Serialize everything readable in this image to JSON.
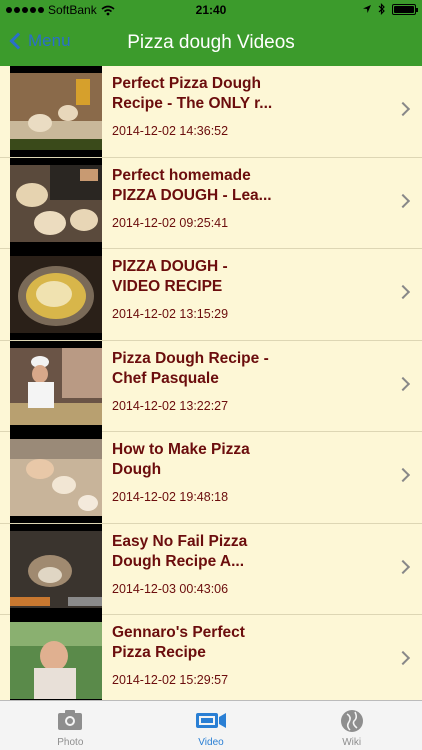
{
  "status_bar": {
    "carrier": "SoftBank",
    "time": "21:40"
  },
  "nav": {
    "back_label": "Menu",
    "title": "Pizza dough Videos"
  },
  "videos": [
    {
      "title": "Perfect Pizza Dough\nRecipe - The ONLY r...",
      "date": "2014-12-02 14:36:52"
    },
    {
      "title": "Perfect homemade\nPIZZA DOUGH - Lea...",
      "date": "2014-12-02 09:25:41"
    },
    {
      "title": "PIZZA DOUGH -\nVIDEO RECIPE",
      "date": "2014-12-02 13:15:29"
    },
    {
      "title": "Pizza Dough Recipe -\nChef Pasquale",
      "date": "2014-12-02 13:22:27"
    },
    {
      "title": "How to Make Pizza\nDough",
      "date": "2014-12-02 19:48:18"
    },
    {
      "title": "Easy No Fail Pizza\nDough Recipe A...",
      "date": "2014-12-03 00:43:06"
    },
    {
      "title": "Gennaro's Perfect\nPizza Recipe",
      "date": "2014-12-02 15:29:57"
    }
  ],
  "tabs": [
    {
      "label": "Photo",
      "icon": "camera-icon",
      "active": false
    },
    {
      "label": "Video",
      "icon": "video-camera-icon",
      "active": true
    },
    {
      "label": "Wiki",
      "icon": "globe-icon",
      "active": false
    }
  ],
  "colors": {
    "bar_green": "#3c9b2c",
    "list_bg": "#fdf7d6",
    "title_text": "#6b0d0d",
    "active_tab": "#2a7fd4"
  }
}
